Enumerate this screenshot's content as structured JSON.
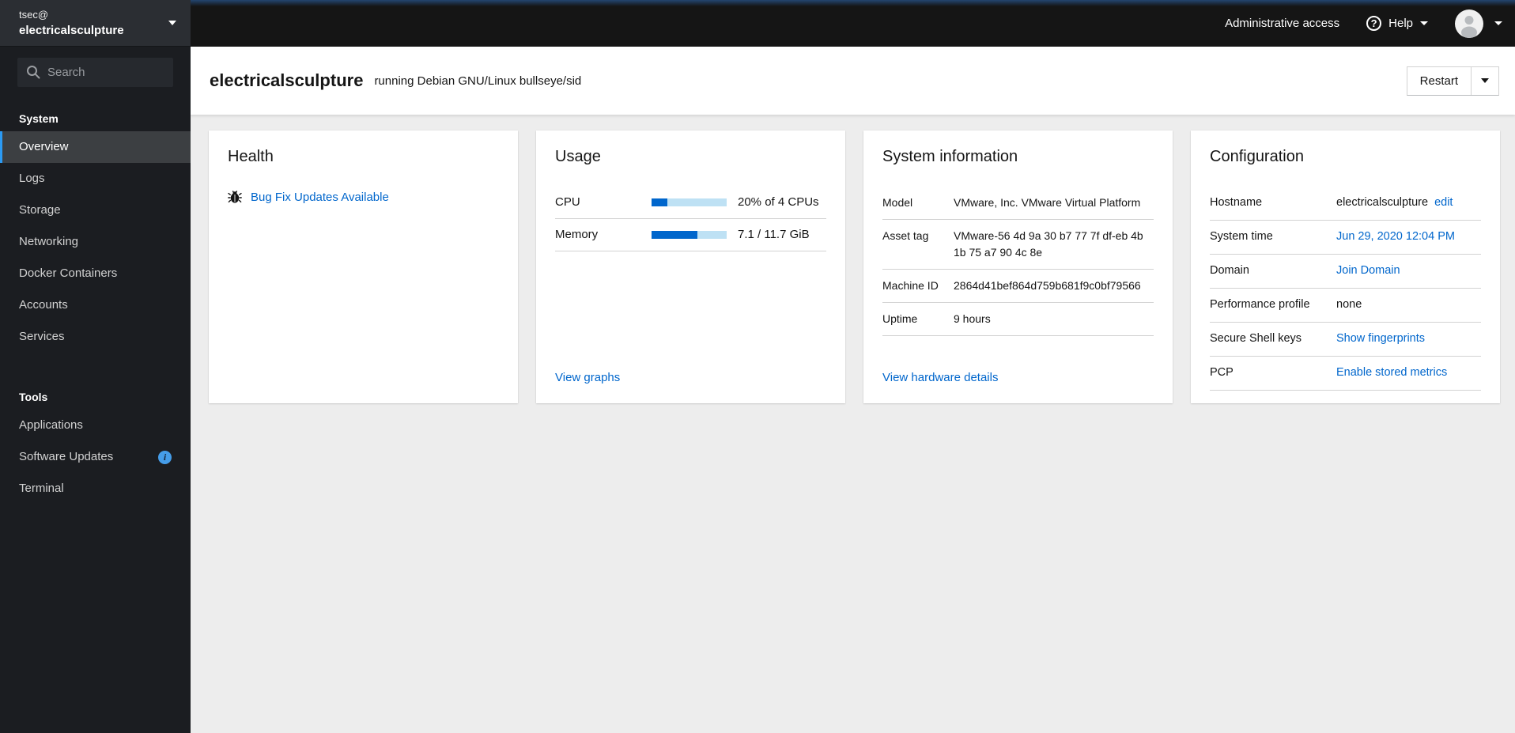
{
  "host_switcher": {
    "user": "tsec@",
    "host": "electricalsculpture"
  },
  "sidebar": {
    "search_placeholder": "Search",
    "sections": [
      {
        "label": "System",
        "items": [
          {
            "label": "Overview"
          },
          {
            "label": "Logs"
          },
          {
            "label": "Storage"
          },
          {
            "label": "Networking"
          },
          {
            "label": "Docker Containers"
          },
          {
            "label": "Accounts"
          },
          {
            "label": "Services"
          }
        ]
      },
      {
        "label": "Tools",
        "items": [
          {
            "label": "Applications"
          },
          {
            "label": "Software Updates",
            "badge": "info"
          },
          {
            "label": "Terminal"
          }
        ]
      }
    ]
  },
  "masthead": {
    "admin_access_label": "Administrative access",
    "help_label": "Help"
  },
  "page_header": {
    "hostname": "electricalsculpture",
    "os_text": "running Debian GNU/Linux bullseye/sid",
    "restart_label": "Restart"
  },
  "cards": {
    "health": {
      "title": "Health",
      "update_link": "Bug Fix Updates Available"
    },
    "usage": {
      "title": "Usage",
      "rows": [
        {
          "label": "CPU",
          "percent": 21,
          "value": "20% of 4 CPUs"
        },
        {
          "label": "Memory",
          "percent": 61,
          "value": "7.1 / 11.7 GiB"
        }
      ],
      "view_graphs_label": "View graphs"
    },
    "system_information": {
      "title": "System information",
      "rows": [
        {
          "label": "Model",
          "value": "VMware, Inc. VMware Virtual Platform"
        },
        {
          "label": "Asset tag",
          "value": "VMware-56 4d 9a 30 b7 77 7f df-eb 4b 1b 75 a7 90 4c 8e"
        },
        {
          "label": "Machine ID",
          "value": "2864d41bef864d759b681f9c0bf79566"
        },
        {
          "label": "Uptime",
          "value": "9 hours"
        }
      ],
      "details_link": "View hardware details"
    },
    "configuration": {
      "title": "Configuration",
      "rows": [
        {
          "label": "Hostname",
          "value": "electricalsculpture",
          "link": "edit"
        },
        {
          "label": "System time",
          "link": "Jun 29, 2020 12:04 PM"
        },
        {
          "label": "Domain",
          "link": "Join Domain"
        },
        {
          "label": "Performance profile",
          "value": "none"
        },
        {
          "label": "Secure Shell keys",
          "link": "Show fingerprints"
        },
        {
          "label": "PCP",
          "link": "Enable stored metrics"
        }
      ]
    }
  },
  "colors": {
    "link_blue": "#0066cc",
    "progress_fill": "#0066cc",
    "progress_track": "#bee1f4",
    "nav_active_border": "#2b9af3",
    "info_badge": "#459de9",
    "masthead_bg": "#151515",
    "sidebar_bg": "#1b1d21",
    "content_bg": "#ededed"
  }
}
